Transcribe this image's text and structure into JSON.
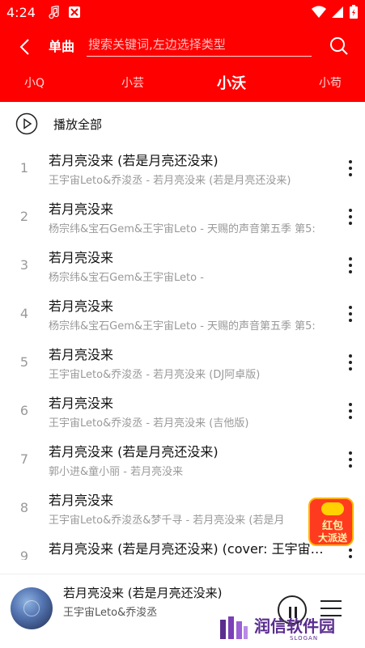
{
  "status_bar": {
    "time": "4:24"
  },
  "header": {
    "type_label": "单曲",
    "search_placeholder": "搜索关键词,左边选择类型"
  },
  "tabs": [
    {
      "label": "小Q",
      "active": false
    },
    {
      "label": "小芸",
      "active": false
    },
    {
      "label": "小沃",
      "active": true
    },
    {
      "label": "小苟",
      "active": false
    }
  ],
  "play_all_label": "播放全部",
  "songs": [
    {
      "index": "1",
      "title": "若月亮没来 (若是月亮还没来)",
      "subtitle": "王宇宙Leto&乔浚丞 - 若月亮没来 (若是月亮还没来)"
    },
    {
      "index": "2",
      "title": "若月亮没来",
      "subtitle": "杨宗纬&宝石Gem&王宇宙Leto - 天赐的声音第五季 第5:"
    },
    {
      "index": "3",
      "title": "若月亮没来",
      "subtitle": "杨宗纬&宝石Gem&王宇宙Leto -"
    },
    {
      "index": "4",
      "title": "若月亮没来",
      "subtitle": "杨宗纬&宝石Gem&王宇宙Leto - 天赐的声音第五季 第5:"
    },
    {
      "index": "5",
      "title": "若月亮没来",
      "subtitle": "王宇宙Leto&乔浚丞 - 若月亮没来 (DJ阿卓版)"
    },
    {
      "index": "6",
      "title": "若月亮没来",
      "subtitle": "王宇宙Leto&乔浚丞 - 若月亮没来 (吉他版)"
    },
    {
      "index": "7",
      "title": "若月亮没来 (若是月亮还没来)",
      "subtitle": "郭小进&童小丽 - 若月亮没来"
    },
    {
      "index": "8",
      "title": "若月亮没来",
      "subtitle": "王宇宙Leto&乔浚丞&梦千寻 - 若月亮没来 (若是月"
    },
    {
      "index": "9",
      "title": "若月亮没来 (若是月亮还没来) (cover: 王宇宙…",
      "subtitle": ""
    }
  ],
  "red_envelope": {
    "line1": "红包",
    "line2": "大派送"
  },
  "player": {
    "title": "若月亮没来 (若是月亮还没来)",
    "artist": "王宇宙Leto&乔浚丞"
  },
  "watermark": {
    "text": "润信软件园",
    "slogan": "SLOGAN"
  },
  "colors": {
    "brand_red": "#ff0000",
    "watermark_purple": "#5a2d8f"
  }
}
